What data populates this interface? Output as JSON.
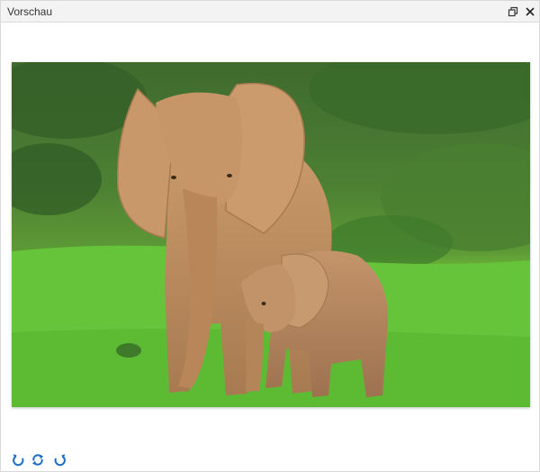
{
  "window": {
    "title": "Vorschau"
  },
  "titlebar_buttons": [
    {
      "icon": "restore-window-icon"
    },
    {
      "icon": "close-icon"
    }
  ],
  "footer_tools": [
    {
      "icon": "rotate-left-icon"
    },
    {
      "icon": "flip-icon"
    },
    {
      "icon": "rotate-right-icon"
    }
  ],
  "image": {
    "subject": "elephant-mother-and-calf-photo"
  },
  "colors": {
    "accent": "#1f6fc5",
    "titlebar_bg": "#f3f3f3"
  }
}
